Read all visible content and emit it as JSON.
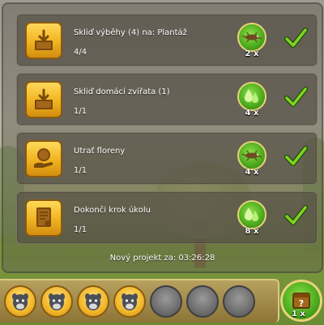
{
  "tasks": [
    {
      "title": "Skliď výběhy (4) na: Plantáž",
      "progress": "4/4",
      "icon": "harvest-box-icon",
      "reward_icon": "lizard-reward-icon",
      "reward_count": "2 x",
      "completed": true
    },
    {
      "title": "Skliď domácí zvířata (1)",
      "progress": "1/1",
      "icon": "harvest-box-icon",
      "reward_icon": "water-drops-reward-icon",
      "reward_count": "4 x",
      "completed": true
    },
    {
      "title": "Utrať floreny",
      "progress": "1/1",
      "icon": "coins-hand-icon",
      "reward_icon": "lizard-reward-icon",
      "reward_count": "4 x",
      "completed": true
    },
    {
      "title": "Dokonči krok úkolu",
      "progress": "1/1",
      "icon": "quest-scroll-icon",
      "reward_icon": "water-drops-reward-icon",
      "reward_count": "8 x",
      "completed": true
    }
  ],
  "timer_text": "Nový projekt za: 03:26:28",
  "progress_slots": {
    "filled": 4,
    "total": 7,
    "filled_icon": "animal-head-icon"
  },
  "final_reward": {
    "icon": "mystery-box-icon",
    "count": "1 x"
  },
  "colors": {
    "check": "#7ed321",
    "task_icon": "#f0b31f",
    "reward": "#4fae1f"
  }
}
